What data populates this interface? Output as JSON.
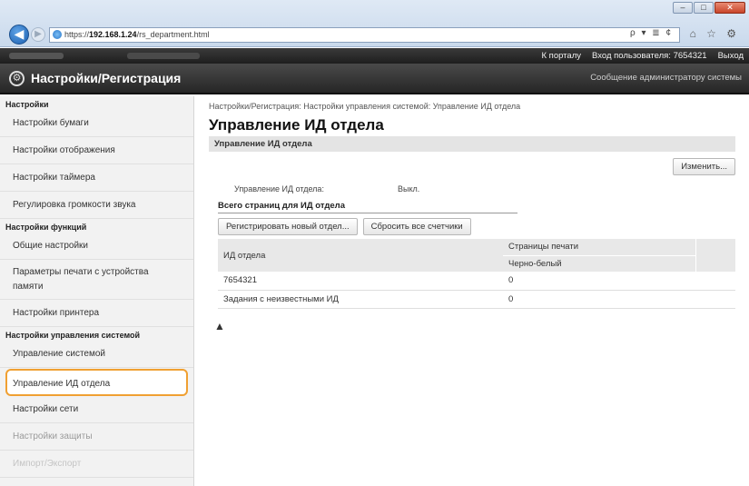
{
  "browser": {
    "address_scheme": "https://",
    "address_host": "192.168.1.24",
    "address_path": "/rs_department.html",
    "address_tools": "ρ ▾ ≣ ¢",
    "nav_icons": "⌂ ☆ ⚙",
    "back_glyph": "◀",
    "forward_glyph": "▶"
  },
  "topbar": {
    "portal_link": "К порталу",
    "user_login": "Вход пользователя:",
    "user_id": "7654321",
    "logout": "Выход"
  },
  "app": {
    "title": "Настройки/Регистрация",
    "admin_message": "Сообщение администратору системы"
  },
  "sidebar": {
    "section_settings": "Настройки",
    "paper": "Настройки бумаги",
    "display": "Настройки отображения",
    "timer": "Настройки таймера",
    "volume": "Регулировка громкости звука",
    "section_functions": "Настройки функций",
    "common": "Общие настройки",
    "memory_print": "Параметры печати с устройства памяти",
    "printer": "Настройки принтера",
    "section_system": "Настройки управления системой",
    "system_mgmt": "Управление системой",
    "dept_id": "Управление ИД отдела",
    "network": "Настройки сети",
    "security": "Настройки защиты",
    "import_export": "Импорт/Экспорт"
  },
  "main": {
    "breadcrumb": "Настройки/Регистрация: Настройки управления системой: Управление ИД отдела",
    "title": "Управление ИД отдела",
    "section": "Управление ИД отдела",
    "change_button": "Изменить...",
    "status_label": "Управление ИД отдела:",
    "status_value": "Выкл.",
    "total_pages_head": "Всего страниц для ИД отдела",
    "register_button": "Регистрировать новый отдел...",
    "reset_button": "Сбросить все счетчики",
    "table": {
      "col_id": "ИД отдела",
      "col_pages": "Страницы печати",
      "col_bw": "Черно-белый",
      "rows": [
        {
          "id": "7654321",
          "bw": "0"
        },
        {
          "id": "Задания с неизвестными ИД",
          "bw": "0"
        }
      ]
    },
    "top_link": "▲"
  }
}
